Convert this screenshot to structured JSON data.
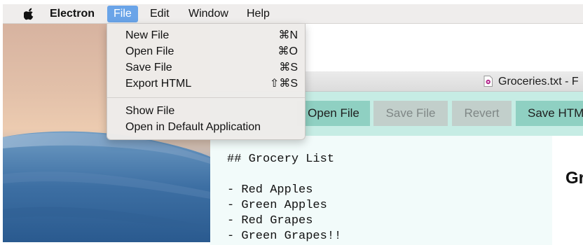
{
  "menubar": {
    "app_name": "Electron",
    "menus": [
      "File",
      "Edit",
      "Window",
      "Help"
    ]
  },
  "file_menu": {
    "items": [
      {
        "label": "New File",
        "shortcut": "⌘N"
      },
      {
        "label": "Open File",
        "shortcut": "⌘O"
      },
      {
        "label": "Save File",
        "shortcut": "⌘S"
      },
      {
        "label": "Export HTML",
        "shortcut": "⇧⌘S"
      },
      {
        "label": "Show File",
        "shortcut": ""
      },
      {
        "label": "Open in Default Application",
        "shortcut": ""
      }
    ]
  },
  "window": {
    "title": "Groceries.txt - F",
    "toolbar": {
      "buttons": [
        {
          "label": "Open File",
          "enabled": true
        },
        {
          "label": "Save File",
          "enabled": false
        },
        {
          "label": "Revert",
          "enabled": false
        },
        {
          "label": "Save HTML",
          "enabled": true
        }
      ]
    },
    "editor": {
      "lines": [
        "## Grocery List",
        "",
        "- Red Apples",
        "- Green Apples",
        "- Red Grapes",
        "- Green Grapes!!"
      ]
    },
    "preview": {
      "heading": "Gr"
    }
  },
  "icons": {
    "apple": "apple-logo-icon",
    "document": "document-icon"
  },
  "colors": {
    "menu_highlight": "#6aa4e8",
    "toolbar_bg": "#c6ece4",
    "button_enabled": "#8fd0c2",
    "button_disabled": "#c2cfcb",
    "editor_bg": "#f2fbfa"
  }
}
